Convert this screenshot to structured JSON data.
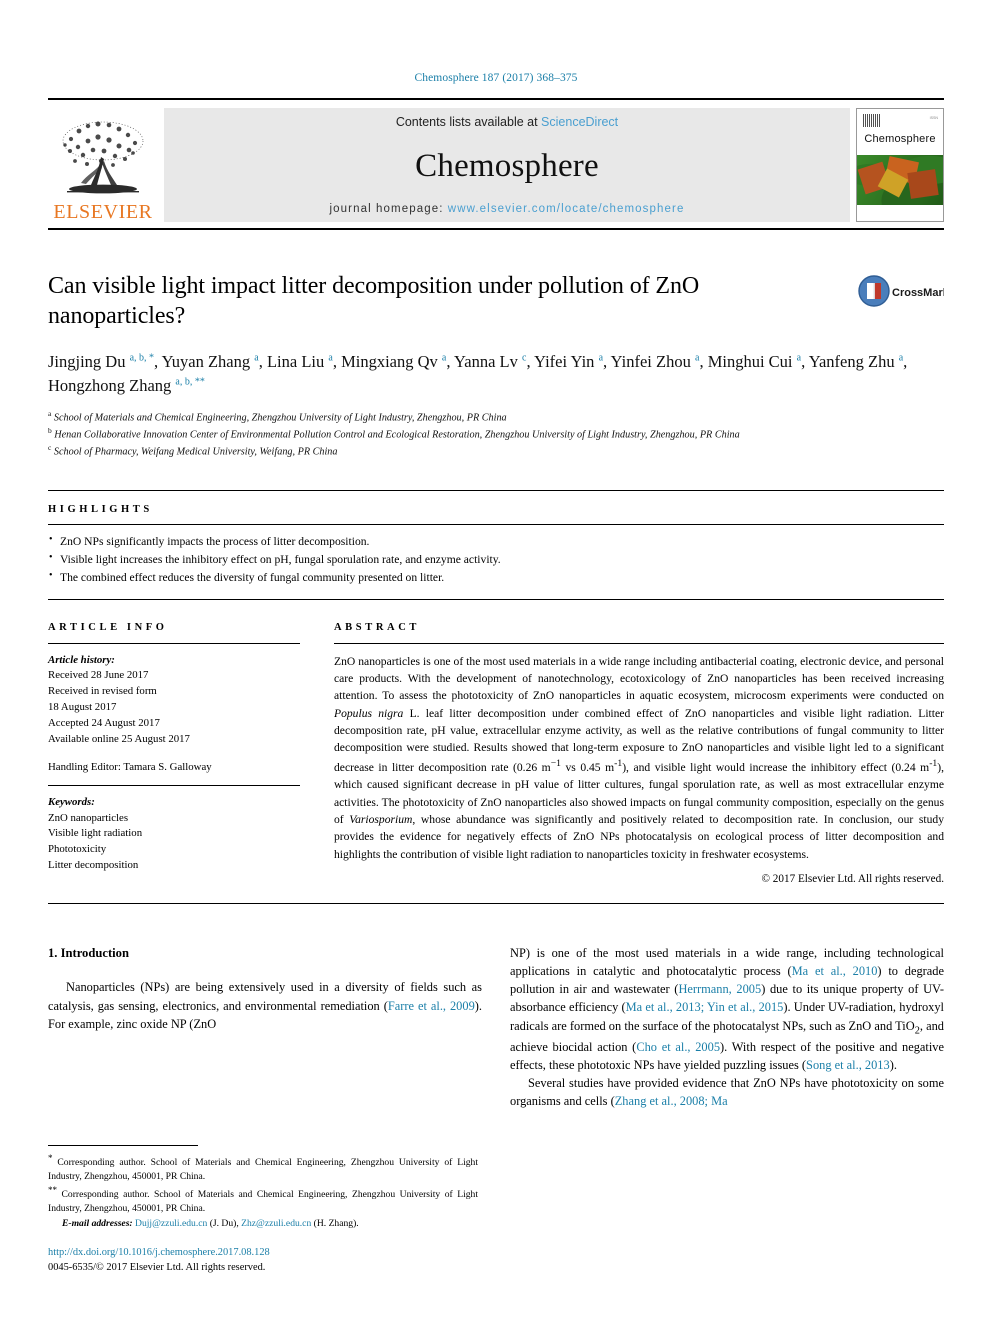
{
  "running_head": "Chemosphere 187 (2017) 368–375",
  "masthead": {
    "publisher": "ELSEVIER",
    "contents_prefix": "Contents lists available at ",
    "contents_link": "ScienceDirect",
    "journal_title": "Chemosphere",
    "homepage_prefix": "journal homepage: ",
    "homepage_url": "www.elsevier.com/locate/chemosphere",
    "cover_journal_name": "Chemosphere",
    "accent_link_color": "#4a9fd0",
    "elsevier_orange": "#e87722"
  },
  "article": {
    "title": "Can visible light impact litter decomposition under pollution of ZnO nanoparticles?",
    "crossmark_label": "CrossMark",
    "authors_line_1": "Jingjing Du",
    "authors_html": "Jingjing Du <sup>a, b, *</sup>, Yuyan Zhang <sup>a</sup>, Lina Liu <sup>a</sup>, Mingxiang Qv <sup>a</sup>, Yanna Lv <sup>c</sup>, Yifei Yin <sup>a</sup>, Yinfei Zhou <sup>a</sup>, Minghui Cui <sup>a</sup>, Yanfeng Zhu <sup>a</sup>, Hongzhong Zhang <sup>a, b, **</sup>",
    "affiliations": [
      {
        "marker": "a",
        "text": "School of Materials and Chemical Engineering, Zhengzhou University of Light Industry, Zhengzhou, PR China"
      },
      {
        "marker": "b",
        "text": "Henan Collaborative Innovation Center of Environmental Pollution Control and Ecological Restoration, Zhengzhou University of Light Industry, Zhengzhou, PR China"
      },
      {
        "marker": "c",
        "text": "School of Pharmacy, Weifang Medical University, Weifang, PR China"
      }
    ]
  },
  "highlights": {
    "heading": "HIGHLIGHTS",
    "items": [
      "ZnO NPs significantly impacts the process of litter decomposition.",
      "Visible light increases the inhibitory effect on pH, fungal sporulation rate, and enzyme activity.",
      "The combined effect reduces the diversity of fungal community presented on litter."
    ]
  },
  "article_info": {
    "heading": "ARTICLE INFO",
    "history_label": "Article history:",
    "history": [
      "Received 28 June 2017",
      "Received in revised form",
      "18 August 2017",
      "Accepted 24 August 2017",
      "Available online 25 August 2017"
    ],
    "handling_editor": "Handling Editor: Tamara S. Galloway",
    "keywords_label": "Keywords:",
    "keywords": [
      "ZnO nanoparticles",
      "Visible light radiation",
      "Phototoxicity",
      "Litter decomposition"
    ]
  },
  "abstract": {
    "heading": "ABSTRACT",
    "text_html": "ZnO nanoparticles is one of the most used materials in a wide range including antibacterial coating, electronic device, and personal care products. With the development of nanotechnology, ecotoxicology of ZnO nanoparticles has been received increasing attention. To assess the phototoxicity of ZnO nanoparticles in aquatic ecosystem, microcosm experiments were conducted on <i>Populus nigra</i> L. leaf litter decomposition under combined effect of ZnO nanoparticles and visible light radiation. Litter decomposition rate, pH value, extracellular enzyme activity, as well as the relative contributions of fungal community to litter decomposition were studied. Results showed that long-term exposure to ZnO nanoparticles and visible light led to a significant decrease in litter decomposition rate (0.26 m<sup>&minus;1</sup> vs 0.45 m<sup>-1</sup>), and visible light would increase the inhibitory effect (0.24 m<sup>-1</sup>), which caused significant decrease in pH value of litter cultures, fungal sporulation rate, as well as most extracellular enzyme activities. The phototoxicity of ZnO nanoparticles also showed impacts on fungal community composition, especially on the genus of <i>Variosporium</i>, whose abundance was significantly and positively related to decomposition rate. In conclusion, our study provides the evidence for negatively effects of ZnO NPs photocatalysis on ecological process of litter decomposition and highlights the contribution of visible light radiation to nanoparticles toxicity in freshwater ecosystems.",
    "copyright": "© 2017 Elsevier Ltd. All rights reserved."
  },
  "body": {
    "section_number_title": "1. Introduction",
    "left_paragraph_html": "Nanoparticles (NPs) are being extensively used in a diversity of fields such as catalysis, gas sensing, electronics, and environmental remediation (<span class=\"ref\">Farre et al., 2009</span>). For example, zinc oxide NP (ZnO",
    "right_paragraph_1_html": "NP) is one of the most used materials in a wide range, including technological applications in catalytic and photocatalytic process (<span class=\"ref\">Ma et al., 2010</span>) to degrade pollution in air and wastewater (<span class=\"ref\">Herrmann, 2005</span>) due to its unique property of UV-absorbance efficiency (<span class=\"ref\">Ma et al., 2013; Yin et al., 2015</span>). Under UV-radiation, hydroxyl radicals are formed on the surface of the photocatalyst NPs, such as ZnO and TiO<sub>2</sub>, and achieve biocidal action (<span class=\"ref\">Cho et al., 2005</span>). With respect of the positive and negative effects, these phototoxic NPs have yielded puzzling issues (<span class=\"ref\">Song et al., 2013</span>).",
    "right_paragraph_2_html": "Several studies have provided evidence that ZnO NPs have phototoxicity on some organisms and cells (<span class=\"ref\">Zhang et al., 2008; Ma</span>"
  },
  "footnotes": {
    "corresponding_1_html": "<sup>*</sup> Corresponding author. School of Materials and Chemical Engineering, Zhengzhou University of Light Industry, Zhengzhou, 450001, PR China.",
    "corresponding_2_html": "<sup>**</sup> Corresponding author. School of Materials and Chemical Engineering, Zhengzhou University of Light Industry, Zhengzhou, 450001, PR China.",
    "email_label": "E-mail addresses:",
    "email_1": "Dujj@zzuli.edu.cn",
    "email_1_owner": "(J. Du),",
    "email_2": "Zhz@zzuli.edu.cn",
    "email_2_owner": "(H. Zhang).",
    "doi": "http://dx.doi.org/10.1016/j.chemosphere.2017.08.128",
    "issn_line": "0045-6535/© 2017 Elsevier Ltd. All rights reserved."
  }
}
